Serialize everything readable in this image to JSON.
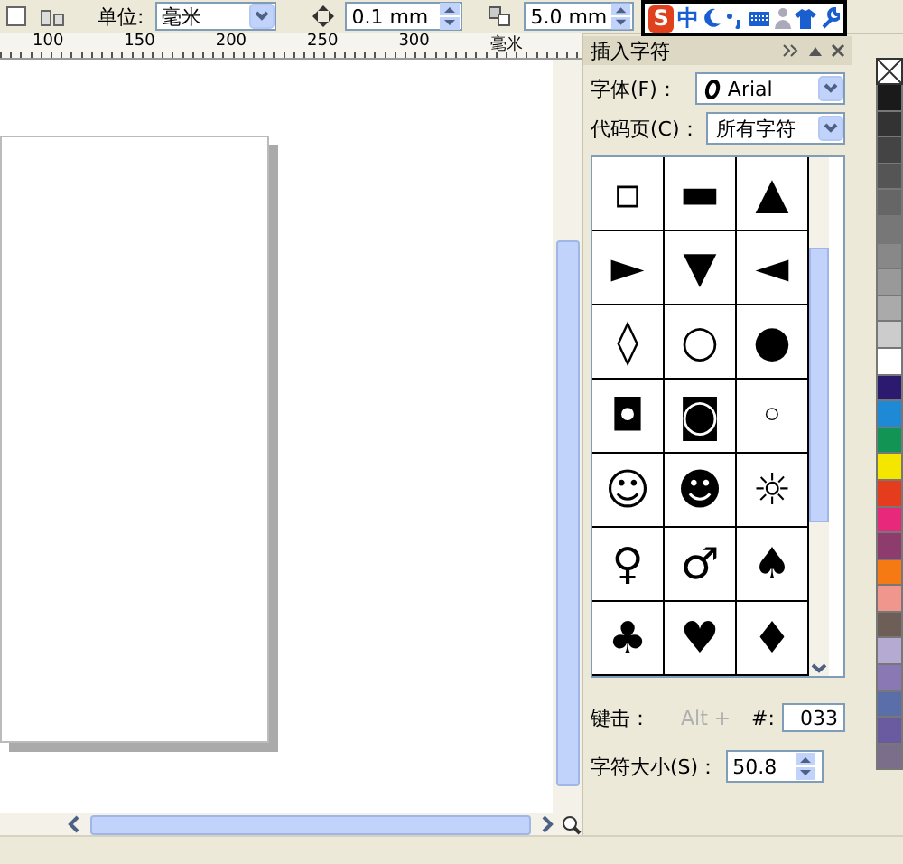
{
  "toolbar": {
    "unit_label": "单位:",
    "unit_value": "毫米",
    "nudge_value": "0.1 mm",
    "duplicate_value": "5.0 mm"
  },
  "ruler": {
    "ticks": [
      "100",
      "150",
      "200",
      "250",
      "300"
    ],
    "unit": "毫米"
  },
  "ime_bar": {
    "logo": "S",
    "mode": "中"
  },
  "docker": {
    "title": "插入字符",
    "font_label": "字体(F)：",
    "font_value": "Arial",
    "code_page_label": "代码页(C)：",
    "code_page_value": "所有字符",
    "characters": [
      "▫",
      "▬",
      "▲",
      "►",
      "▼",
      "◄",
      "◊",
      "○",
      "●",
      "◘",
      "◙",
      "◦",
      "☺",
      "☻",
      "☼",
      "♀",
      "♂",
      "♠",
      "♣",
      "♥",
      "♦"
    ],
    "keystroke_label": "键击：",
    "keystroke_value": "Alt +",
    "keystroke_disabled": true,
    "code_label": "#:",
    "code_value": "033",
    "size_label": "字符大小(S)：",
    "size_value": "50.8"
  },
  "palette": [
    {
      "color": "#1a1a1a"
    },
    {
      "color": "#333333"
    },
    {
      "color": "#444444"
    },
    {
      "color": "#555555"
    },
    {
      "color": "#666666"
    },
    {
      "color": "#777777"
    },
    {
      "color": "#888888"
    },
    {
      "color": "#999999"
    },
    {
      "color": "#aaaaaa"
    },
    {
      "color": "#cccccc"
    },
    {
      "color": "#ffffff"
    },
    {
      "color": "#2b1a6e"
    },
    {
      "color": "#1e8ad6"
    },
    {
      "color": "#129454"
    },
    {
      "color": "#f5e600"
    },
    {
      "color": "#e63c1e"
    },
    {
      "color": "#e8287a"
    },
    {
      "color": "#8e3c6e"
    },
    {
      "color": "#f57a14"
    },
    {
      "color": "#f0968c"
    },
    {
      "color": "#6e5e58"
    },
    {
      "color": "#b4aad2"
    },
    {
      "color": "#8a78b4"
    },
    {
      "color": "#5a6eaa"
    },
    {
      "color": "#6a5aa0"
    },
    {
      "color": "#7a6e8a"
    }
  ]
}
